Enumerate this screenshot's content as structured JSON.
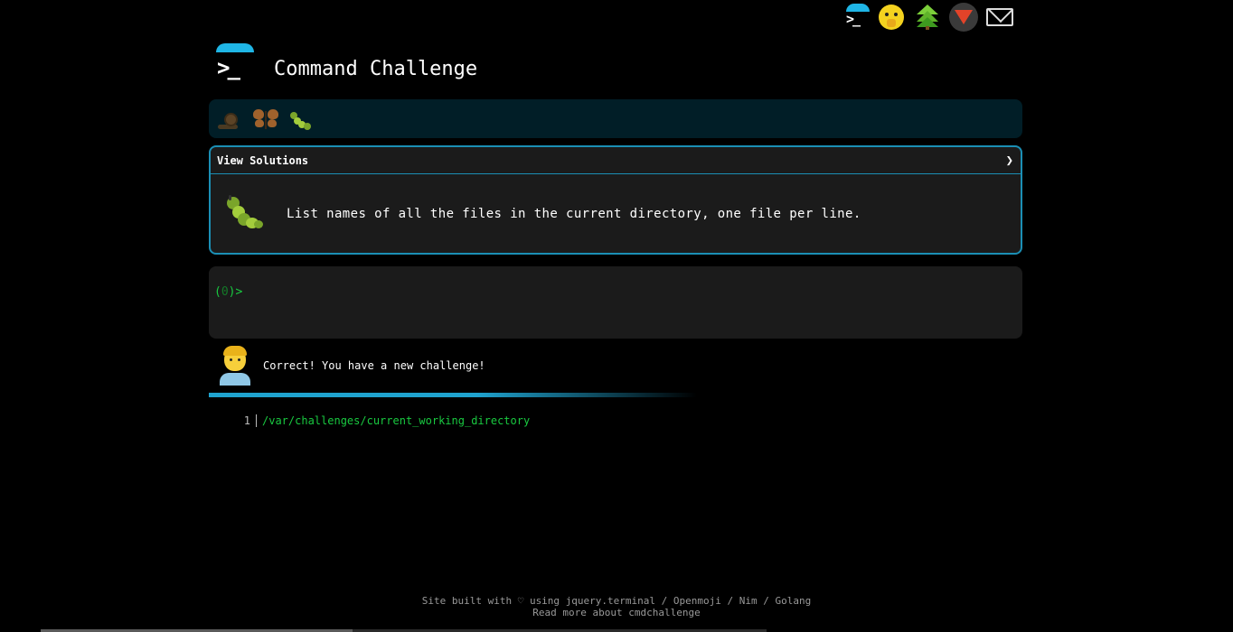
{
  "top_icons": [
    {
      "name": "terminal-logo-icon"
    },
    {
      "name": "shushing-face-icon"
    },
    {
      "name": "tree-icon"
    },
    {
      "name": "gitlab-icon"
    },
    {
      "name": "envelope-icon"
    }
  ],
  "header": {
    "title": "Command Challenge",
    "logo_glyph": ">_"
  },
  "badges": [
    "snail-icon",
    "butterfly-icon",
    "caterpillar-icon"
  ],
  "challenge": {
    "view_solutions_label": "View Solutions",
    "chevron": "❯",
    "text": "List names of all the files in the current directory, one file per line."
  },
  "terminal": {
    "prompt_open": "(",
    "prompt_count": "0",
    "prompt_close": ")>"
  },
  "result": {
    "message": "Correct! You have a new challenge!",
    "output_lines": [
      {
        "line": "1",
        "text": "/var/challenges/current_working_directory"
      }
    ]
  },
  "footer": {
    "line1_prefix": "Site built with ♡ using ",
    "jquery_terminal": "jquery.terminal",
    "sep1": " / ",
    "openmoji": "Openmoji",
    "sep2": " / ",
    "nim": "Nim",
    "sep3": " / ",
    "golang": "Golang",
    "read_more": "Read more about cmdchallenge"
  },
  "colors": {
    "accent": "#1fb6e6",
    "terminal_green": "#19c940",
    "panel_bg": "#1b1b1b",
    "badge_bar_bg": "#011e27"
  }
}
